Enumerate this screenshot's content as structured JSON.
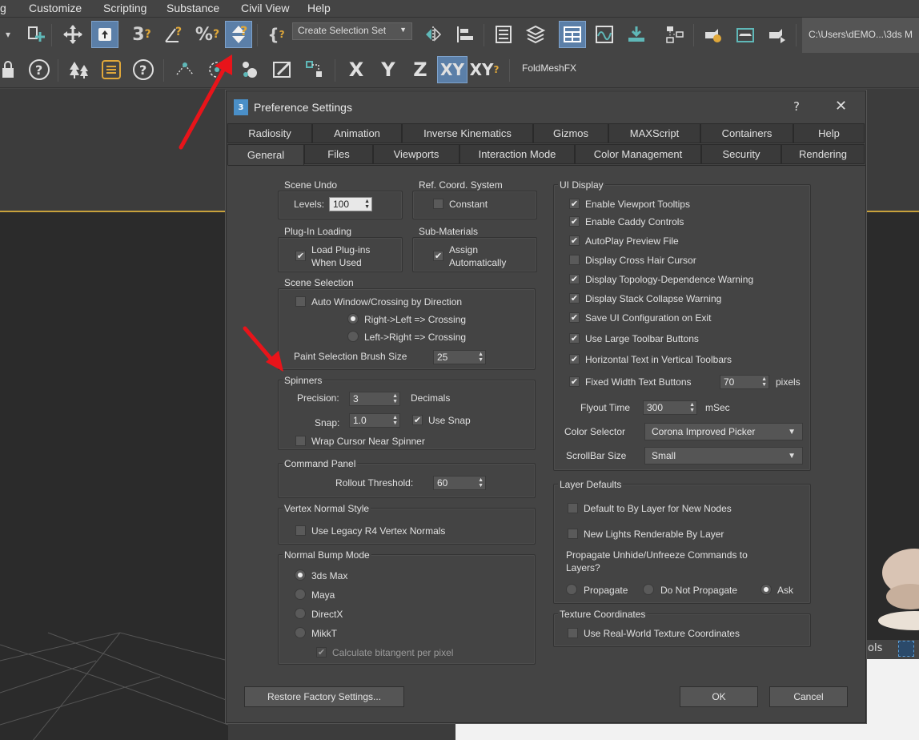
{
  "menubar": {
    "items": [
      "g",
      "Customize",
      "Scripting",
      "Substance",
      "Civil View",
      "Help"
    ]
  },
  "toolbar": {
    "selection_set_label": "Create Selection Set",
    "path": "C:\\Users\\dEMO...\\3ds M",
    "foldmesh": "FoldMeshFX",
    "axes": [
      "X",
      "Y",
      "Z",
      "XY",
      "XY"
    ]
  },
  "viewport": {
    "tools_label": "ols"
  },
  "dialog": {
    "icon": "3",
    "title": "Preference Settings",
    "help_label": "?",
    "close_label": "✕",
    "tabs_row1": [
      "Radiosity",
      "Animation",
      "Inverse Kinematics",
      "Gizmos",
      "MAXScript",
      "Containers",
      "Help"
    ],
    "tabs_row2": [
      "General",
      "Files",
      "Viewports",
      "Interaction Mode",
      "Color Management",
      "Security",
      "Rendering"
    ],
    "selected_tab": "General",
    "scene_undo": {
      "title": "Scene Undo",
      "levels_label": "Levels:",
      "levels_value": "100"
    },
    "ref_coord": {
      "title": "Ref. Coord. System",
      "constant_label": "Constant",
      "constant_checked": false
    },
    "plugin_loading": {
      "title": "Plug-In Loading",
      "load_label_1": "Load Plug-ins",
      "load_label_2": "When Used",
      "load_checked": true
    },
    "sub_materials": {
      "title": "Sub-Materials",
      "assign_label_1": "Assign",
      "assign_label_2": "Automatically",
      "assign_checked": true
    },
    "scene_selection": {
      "title": "Scene Selection",
      "auto_window_label": "Auto Window/Crossing by Direction",
      "auto_window_checked": false,
      "right_left_label": "Right->Left => Crossing",
      "left_right_label": "Left->Right => Crossing",
      "paint_brush_label": "Paint Selection Brush Size",
      "paint_brush_value": "25"
    },
    "spinners": {
      "title": "Spinners",
      "precision_label": "Precision:",
      "precision_value": "3",
      "decimals_label": "Decimals",
      "snap_label": "Snap:",
      "snap_value": "1.0",
      "use_snap_label": "Use Snap",
      "use_snap_checked": true,
      "wrap_label": "Wrap Cursor Near Spinner",
      "wrap_checked": false
    },
    "command_panel": {
      "title": "Command Panel",
      "rollout_label": "Rollout Threshold:",
      "rollout_value": "60"
    },
    "vertex_normal": {
      "title": "Vertex Normal Style",
      "legacy_label": "Use Legacy R4 Vertex Normals",
      "legacy_checked": false
    },
    "normal_bump": {
      "title": "Normal Bump Mode",
      "options": [
        "3ds Max",
        "Maya",
        "DirectX",
        "MikkT"
      ],
      "selected": "3ds Max",
      "bitangent_label": "Calculate bitangent per pixel",
      "bitangent_checked": true
    },
    "ui_display": {
      "title": "UI Display",
      "options": [
        {
          "label": "Enable Viewport Tooltips",
          "checked": true
        },
        {
          "label": "Enable Caddy Controls",
          "checked": true
        },
        {
          "label": "AutoPlay Preview File",
          "checked": true
        },
        {
          "label": "Display Cross Hair Cursor",
          "checked": false
        },
        {
          "label": "Display Topology-Dependence Warning",
          "checked": true
        },
        {
          "label": "Display Stack Collapse Warning",
          "checked": true
        },
        {
          "label": "Save UI Configuration on Exit",
          "checked": true
        },
        {
          "label": "Use Large Toolbar Buttons",
          "checked": true
        },
        {
          "label": "Horizontal Text in Vertical Toolbars",
          "checked": true
        },
        {
          "label": "Fixed Width Text Buttons",
          "checked": true
        }
      ],
      "fixed_width_value": "70",
      "pixels_label": "pixels",
      "flyout_label": "Flyout Time",
      "flyout_value": "300",
      "msec_label": "mSec",
      "color_selector_label": "Color Selector",
      "color_selector_value": "Corona Improved Picker",
      "scrollbar_label": "ScrollBar Size",
      "scrollbar_value": "Small"
    },
    "layer_defaults": {
      "title": "Layer Defaults",
      "default_by_layer_label": "Default to By Layer for New Nodes",
      "default_by_layer_checked": false,
      "new_lights_label": "New Lights Renderable By Layer",
      "new_lights_checked": false,
      "propagate_text_1": "Propagate Unhide/Unfreeze Commands to",
      "propagate_text_2": "Layers?",
      "propagate_options": [
        "Propagate",
        "Do Not Propagate",
        "Ask"
      ],
      "propagate_selected": "Ask"
    },
    "texture_coords": {
      "title": "Texture Coordinates",
      "real_world_label": "Use Real-World Texture Coordinates",
      "real_world_checked": false
    },
    "restore_label": "Restore Factory Settings...",
    "ok_label": "OK",
    "cancel_label": "Cancel"
  },
  "colors": {
    "dialog_bg": "#444444",
    "accent_blue": "#5b7fa8",
    "annotation_red": "#e8141a",
    "viewport_border": "#c8a23c"
  }
}
